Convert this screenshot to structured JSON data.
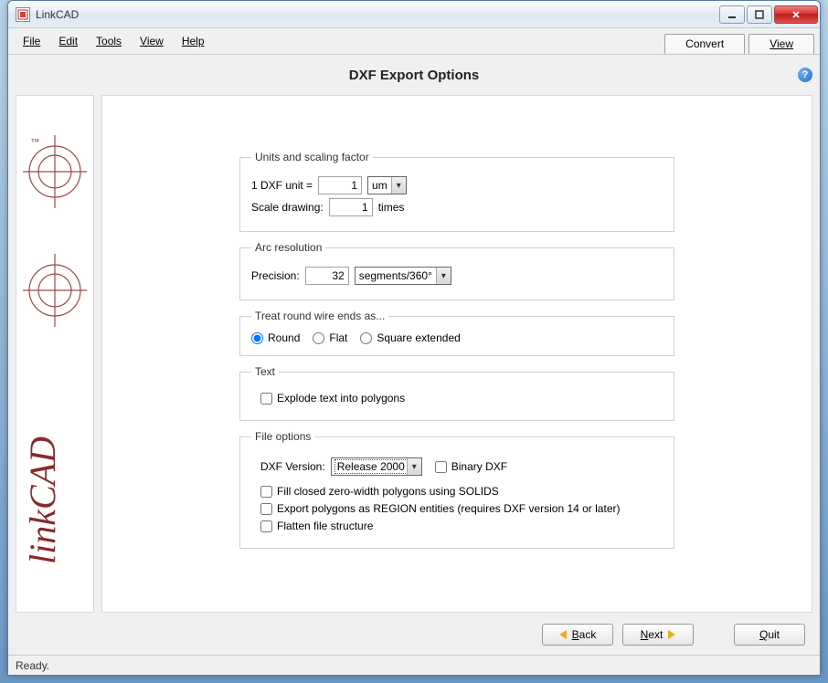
{
  "titlebar": {
    "title": "LinkCAD"
  },
  "menu": {
    "file": "File",
    "edit": "Edit",
    "tools": "Tools",
    "view": "View",
    "help": "Help"
  },
  "modes": {
    "convert": "Convert",
    "view": "View"
  },
  "page": {
    "title": "DXF Export Options"
  },
  "units": {
    "legend": "Units and scaling factor",
    "unit_label_prefix": "1 DXF unit =",
    "unit_value": "1",
    "unit_select": "um",
    "scale_label": "Scale drawing:",
    "scale_value": "1",
    "scale_suffix": "times"
  },
  "arc": {
    "legend": "Arc resolution",
    "precision_label": "Precision:",
    "precision_value": "32",
    "precision_unit": "segments/360°"
  },
  "wireends": {
    "legend": "Treat round wire ends as...",
    "round": "Round",
    "flat": "Flat",
    "square": "Square extended"
  },
  "text": {
    "legend": "Text",
    "explode": "Explode text into polygons"
  },
  "fileopts": {
    "legend": "File options",
    "dxfversion_label": "DXF Version:",
    "dxfversion_value": "Release 2000",
    "binary": "Binary DXF",
    "fill_solids": "Fill closed zero-width polygons using SOLIDS",
    "export_regions": "Export polygons as REGION entities (requires DXF version 14 or later)",
    "flatten": "Flatten file structure"
  },
  "footer": {
    "back": "Back",
    "next": "Next",
    "quit": "Quit"
  },
  "status": {
    "text": "Ready."
  }
}
